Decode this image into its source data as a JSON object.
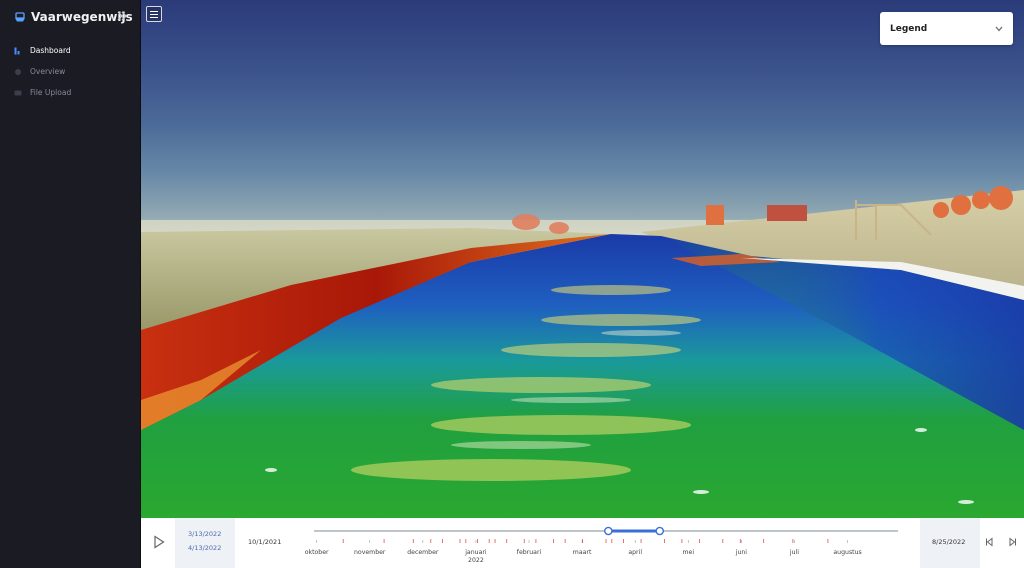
{
  "app": {
    "brand": "Vaarwegenwijs"
  },
  "sidebar": {
    "items": [
      {
        "label": "Dashboard",
        "icon": "chart-icon",
        "active": true
      },
      {
        "label": "Overview",
        "icon": "globe-icon",
        "active": false
      },
      {
        "label": "File Upload",
        "icon": "upload-icon",
        "active": false
      }
    ]
  },
  "legend": {
    "label": "Legend"
  },
  "timeline": {
    "range_start": "3/13/2022",
    "range_end": "4/13/2022",
    "start_date": "10/1/2021",
    "end_date": "8/25/2022",
    "months": [
      "oktober",
      "november",
      "december",
      "januari",
      "februari",
      "maart",
      "april",
      "mei",
      "juni",
      "juli",
      "augustus"
    ],
    "year_label": "2022",
    "selection": {
      "start_fraction": 0.504,
      "end_fraction": 0.592
    }
  },
  "colors": {
    "sidebar_bg": "#1b1b24",
    "accent": "#3a6fd8",
    "marker": "#e05050"
  }
}
